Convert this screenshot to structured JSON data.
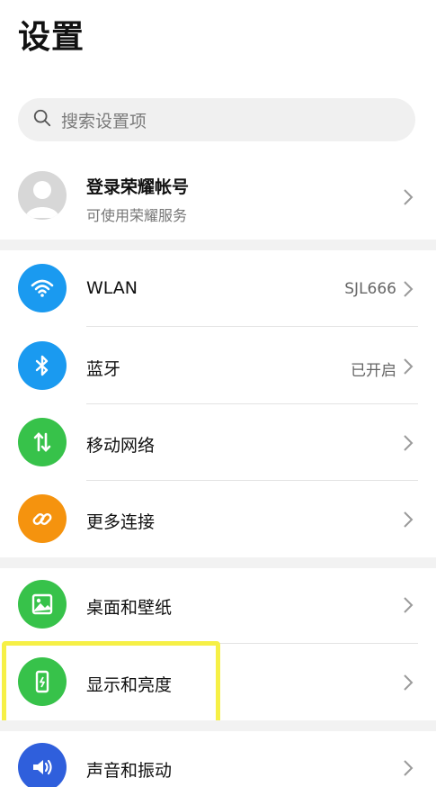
{
  "header": {
    "title": "设置"
  },
  "search": {
    "placeholder": "搜索设置项"
  },
  "account": {
    "title": "登录荣耀帐号",
    "subtitle": "可使用荣耀服务"
  },
  "items": [
    {
      "label": "WLAN",
      "value": "SJL666",
      "icon": "wifi-icon",
      "color": "#1a9af0"
    },
    {
      "label": "蓝牙",
      "value": "已开启",
      "icon": "bluetooth-icon",
      "color": "#1a9af0"
    },
    {
      "label": "移动网络",
      "value": "",
      "icon": "mobile-data-icon",
      "color": "#37c24a"
    },
    {
      "label": "更多连接",
      "value": "",
      "icon": "link-icon",
      "color": "#f5930e"
    },
    {
      "label": "桌面和壁纸",
      "value": "",
      "icon": "wallpaper-icon",
      "color": "#37c24a"
    },
    {
      "label": "显示和亮度",
      "value": "",
      "icon": "display-icon",
      "color": "#37c24a"
    },
    {
      "label": "声音和振动",
      "value": "",
      "icon": "sound-icon",
      "color": "#2f5fdc"
    }
  ],
  "colors": {
    "highlight": "#f6f046",
    "section_gap": "#f2f2f2"
  }
}
